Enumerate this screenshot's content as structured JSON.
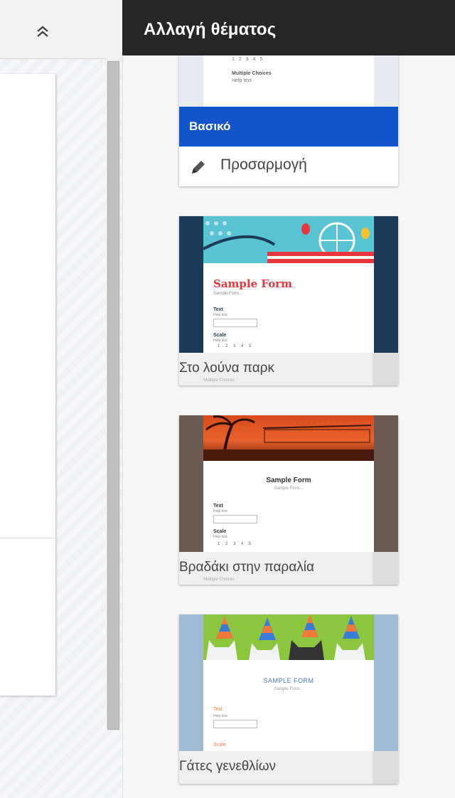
{
  "panel": {
    "title": "Αλλαγή θέματος"
  },
  "themes": [
    {
      "label": "Βασικό",
      "selected": true,
      "preview": {
        "section": "Multiple Choices",
        "help": "Help text",
        "dots": "1 2 3 4 5"
      },
      "customize_label": "Προσαρμογή"
    },
    {
      "label": "Στο λούνα παρκ",
      "preview": {
        "form_title": "Sample Form",
        "desc": "Sample Form...",
        "q1": "Text",
        "q1_help": "Help text",
        "q2": "Scale",
        "q2_help": "Help text",
        "dots": "1 2 3 4 5",
        "section": "Multiple Choices"
      },
      "colors": {
        "bg": "#1c3a57",
        "accent": "#e8363f",
        "sky": "#58c3d3"
      }
    },
    {
      "label": "Βραδάκι στην παραλία",
      "preview": {
        "form_title": "Sample Form",
        "desc": "Sample Form...",
        "q1": "Text",
        "q1_help": "Help text",
        "q2": "Scale",
        "q2_help": "Help text",
        "dots": "1 2 3 4 5",
        "section": "Multiple Choices"
      },
      "colors": {
        "bg": "#6b5a50",
        "accent": "#e15a2a",
        "sky": "#c24527"
      }
    },
    {
      "label": "Γάτες γενεθλίων",
      "preview": {
        "form_title": "SAMPLE FORM",
        "desc": "Sample Form...",
        "q1": "Text",
        "q1_help": "Help text",
        "q2": "Scale"
      },
      "colors": {
        "bg": "#9fbbd6",
        "accent": "#f07a3b",
        "grass": "#8cc63f"
      }
    }
  ]
}
